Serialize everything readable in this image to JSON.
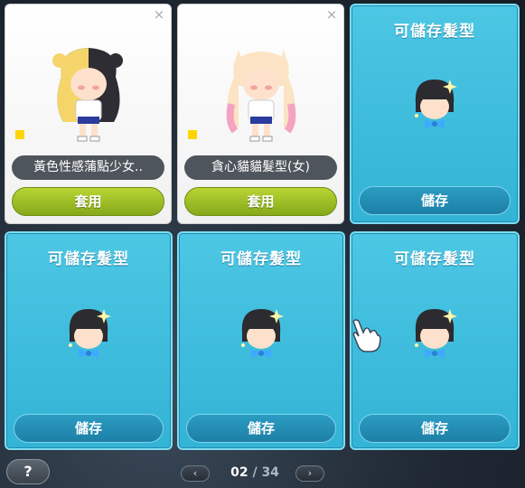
{
  "slots": [
    {
      "state": "used",
      "name": "黃色性感蒲點少女..",
      "apply_label": "套用"
    },
    {
      "state": "used",
      "name": "貪心貓貓髮型(女)",
      "apply_label": "套用"
    },
    {
      "state": "empty",
      "title": "可儲存髮型",
      "save_label": "儲存"
    },
    {
      "state": "empty",
      "title": "可儲存髮型",
      "save_label": "儲存"
    },
    {
      "state": "empty",
      "title": "可儲存髮型",
      "save_label": "儲存"
    },
    {
      "state": "empty",
      "title": "可儲存髮型",
      "save_label": "儲存"
    }
  ],
  "help": {
    "label": "?"
  },
  "pager": {
    "prev_icon": "‹",
    "next_icon": "›",
    "current": "02",
    "separator": "/",
    "total": "34"
  },
  "colors": {
    "slot_bg": "#3ab8dc",
    "apply": "#9cc229",
    "name_pill": "#4f555c"
  },
  "icons": [
    "close-icon",
    "hair-preview-icon",
    "cursor-hand-icon",
    "chevron-left-icon",
    "chevron-right-icon"
  ]
}
